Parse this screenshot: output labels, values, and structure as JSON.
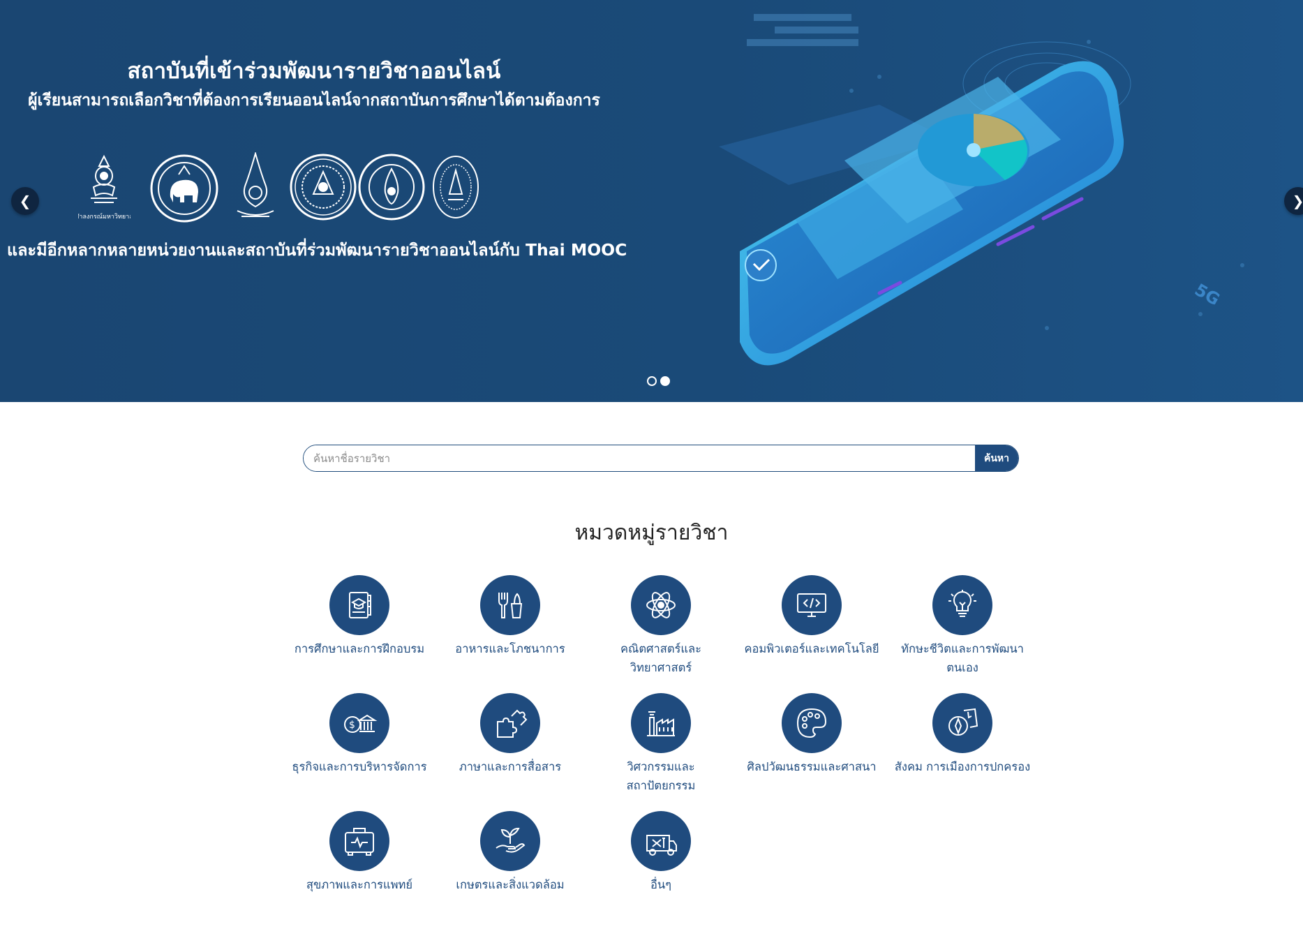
{
  "hero": {
    "title": "สถาบันที่เข้าร่วมพัฒนารายวิชาออนไลน์",
    "subtitle": "ผู้เรียนสามารถเลือกวิชาที่ต้องการเรียนออนไลน์จากสถาบันการศึกษาได้ตามต้องการ",
    "footer": "และมีอีกหลากหลายหน่วยงานและสถาบันที่ร่วมพัฒนารายวิชาออนไลน์กับ Thai MOOC",
    "logo_caption": "จุฬาลงกรณ์มหาวิทยาลัย",
    "prev_icon": "chevron-left-icon",
    "next_icon": "chevron-right-icon",
    "slide_count": 2,
    "active_slide": 2
  },
  "search": {
    "placeholder": "ค้นหาชื่อรายวิชา",
    "button_label": "ค้นหา"
  },
  "categories": {
    "title": "หมวดหมู่รายวิชา",
    "items": [
      {
        "label": "การศึกษาและการฝึกอบรม",
        "icon": "education-book-icon"
      },
      {
        "label": "อาหารและโภชนาการ",
        "icon": "food-utensils-icon"
      },
      {
        "label": "คณิตศาสตร์และ\nวิทยาศาสตร์",
        "icon": "atom-icon"
      },
      {
        "label": "คอมพิวเตอร์และเทคโนโลยี",
        "icon": "computer-code-icon"
      },
      {
        "label": "ทักษะชีวิตและการพัฒนา\nตนเอง",
        "icon": "lightbulb-icon"
      },
      {
        "label": "ธุรกิจและการบริหารจัดการ",
        "icon": "bank-money-icon"
      },
      {
        "label": "ภาษาและการสื่อสาร",
        "icon": "puzzle-icon"
      },
      {
        "label": "วิศวกรรมและ\nสถาปัตยกรรม",
        "icon": "factory-icon"
      },
      {
        "label": "ศิลปวัฒนธรรมและศาสนา",
        "icon": "palette-icon"
      },
      {
        "label": "สังคม การเมืองการปกครอง",
        "icon": "compass-book-icon"
      },
      {
        "label": "สุขภาพและการแพทย์",
        "icon": "medical-kit-icon"
      },
      {
        "label": "เกษตรและสิ่งแวดล้อม",
        "icon": "plant-hand-icon"
      },
      {
        "label": "อื่นๆ",
        "icon": "tools-truck-icon"
      }
    ]
  },
  "colors": {
    "banner": "#1a4672",
    "primary": "#1f4b7e",
    "title_text": "#222222"
  }
}
